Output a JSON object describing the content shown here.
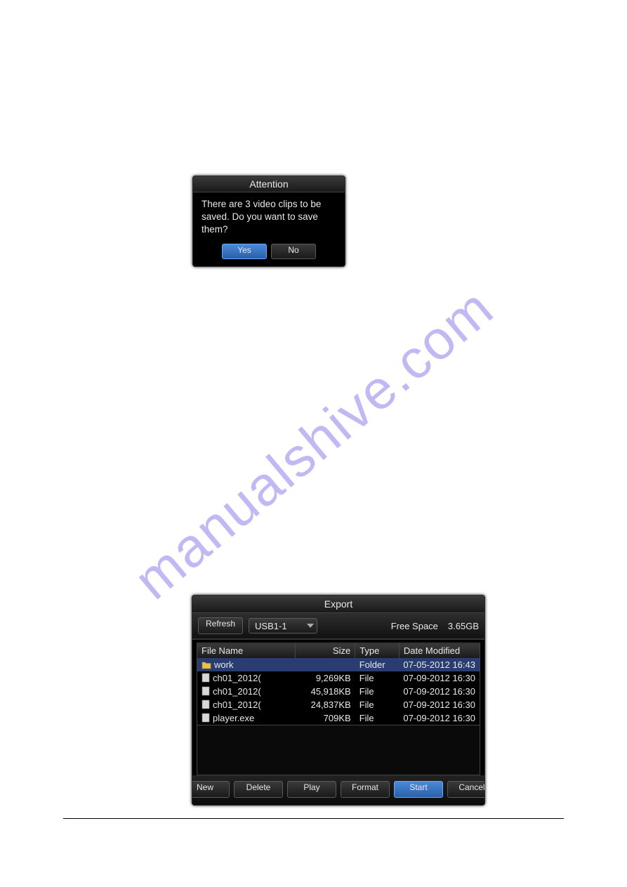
{
  "watermark": "manualshive.com",
  "attention": {
    "title": "Attention",
    "message": "There are 3 video clips to be saved. Do you want to save them?",
    "yes": "Yes",
    "no": "No"
  },
  "export": {
    "title": "Export",
    "refresh": "Refresh",
    "device": "USB1-1",
    "free_space_label": "Free Space",
    "free_space_value": "3.65GB",
    "columns": {
      "name": "File Name",
      "size": "Size",
      "type": "Type",
      "date": "Date Modified"
    },
    "rows": [
      {
        "icon": "folder",
        "selected": true,
        "name": "work",
        "size": "",
        "type": "Folder",
        "date": "07-05-2012 16:43"
      },
      {
        "icon": "file",
        "selected": false,
        "name": "ch01_2012(",
        "size": "9,269KB",
        "type": "File",
        "date": "07-09-2012 16:30"
      },
      {
        "icon": "file",
        "selected": false,
        "name": "ch01_2012(",
        "size": "45,918KB",
        "type": "File",
        "date": "07-09-2012 16:30"
      },
      {
        "icon": "file",
        "selected": false,
        "name": "ch01_2012(",
        "size": "24,837KB",
        "type": "File",
        "date": "07-09-2012 16:30"
      },
      {
        "icon": "file",
        "selected": false,
        "name": "player.exe",
        "size": "709KB",
        "type": "File",
        "date": "07-09-2012 16:30"
      }
    ],
    "buttons": {
      "new": "New",
      "delete": "Delete",
      "play": "Play",
      "format": "Format",
      "start": "Start",
      "cancel": "Cancel"
    }
  }
}
